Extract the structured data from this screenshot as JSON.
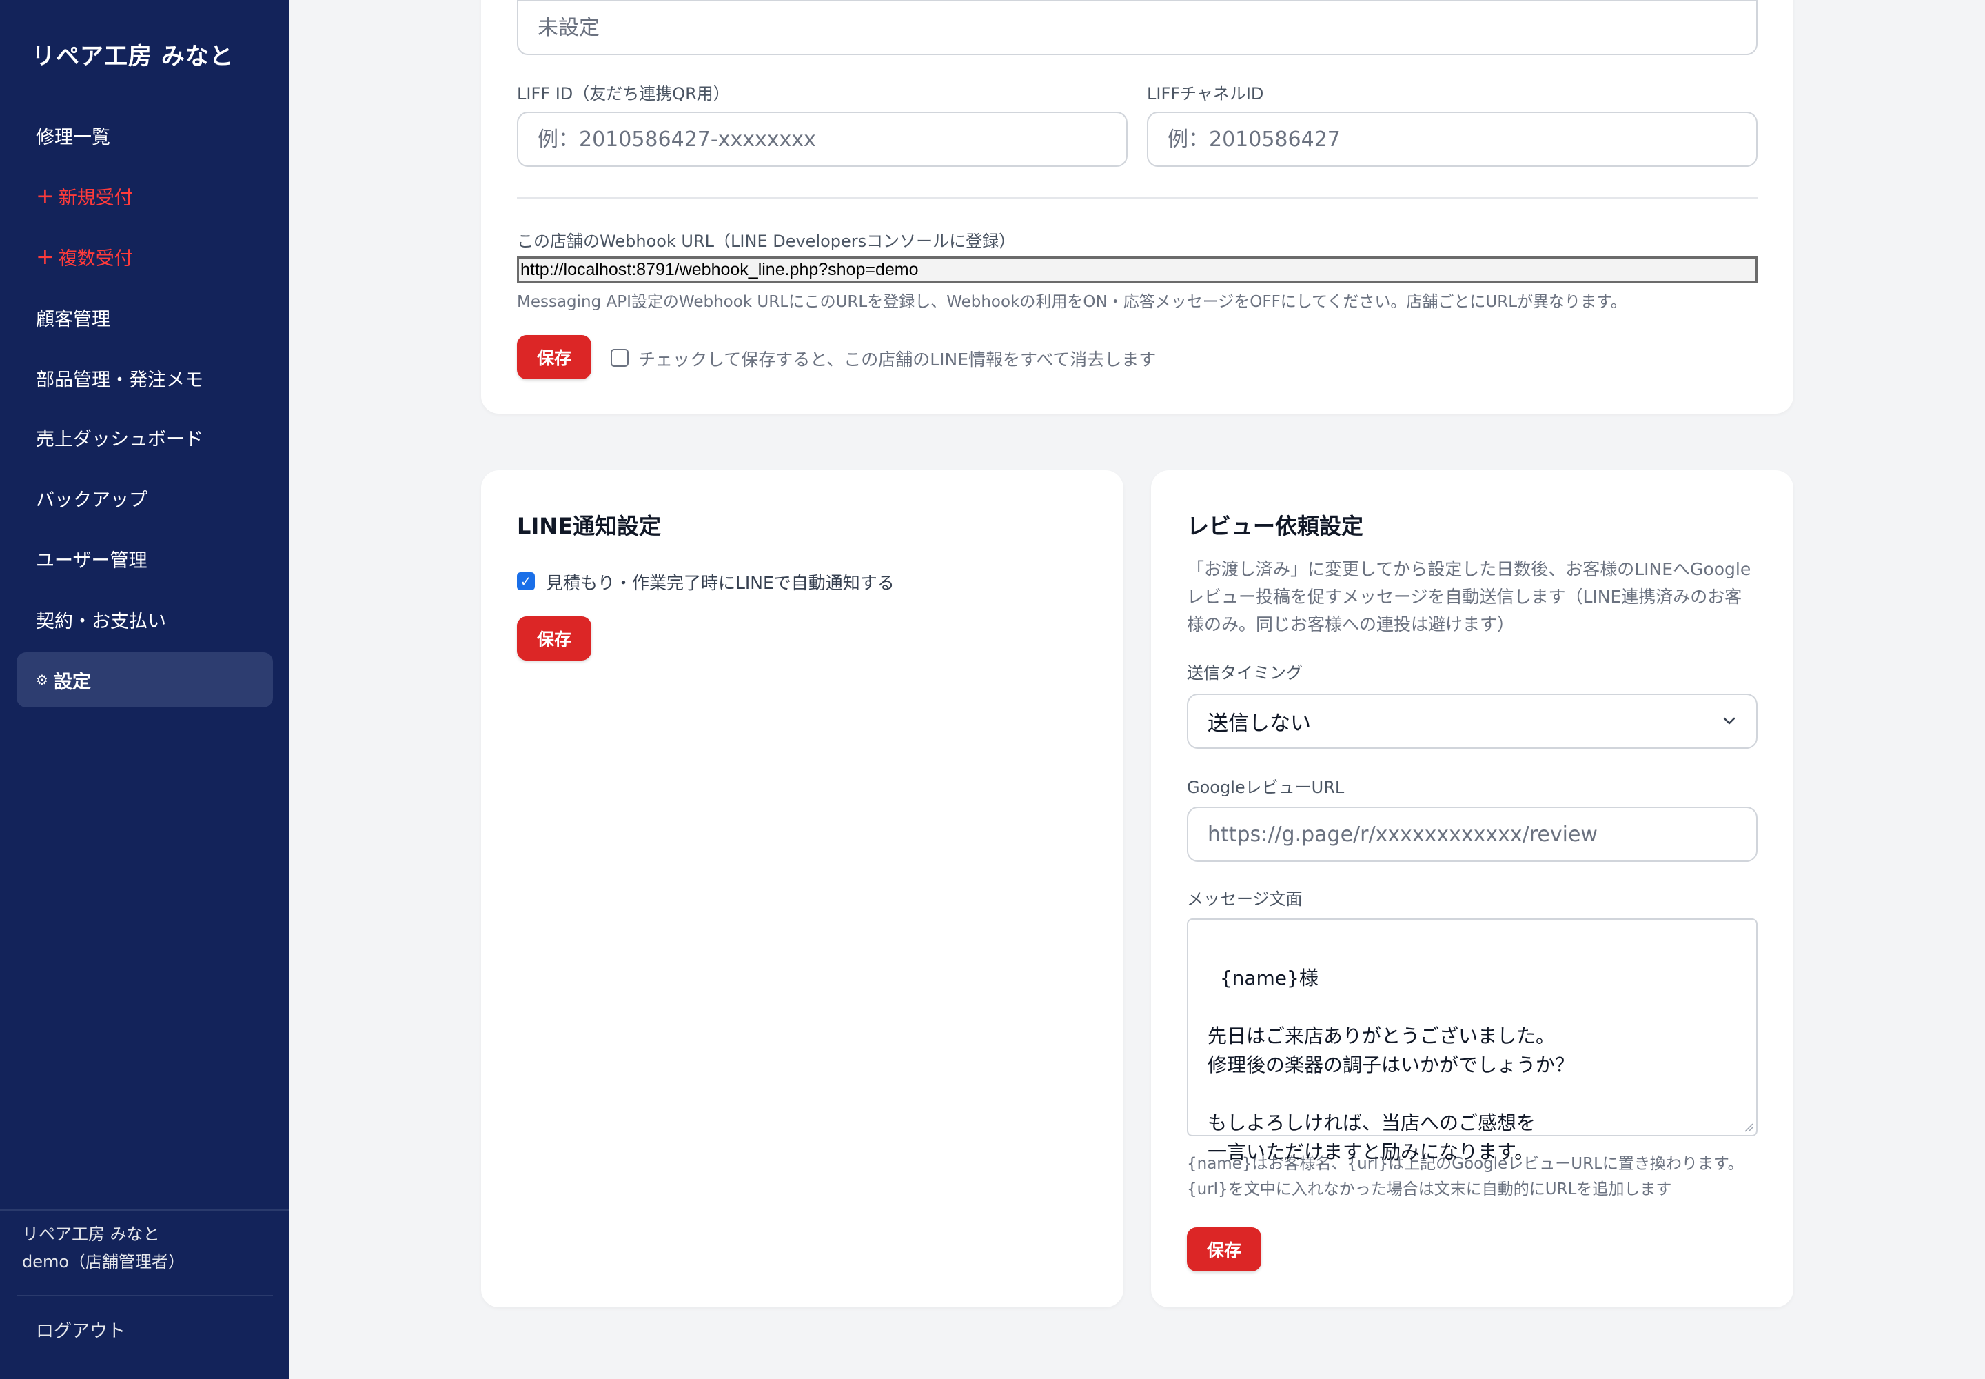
{
  "sidebar": {
    "brand": "リペア工房 みなと",
    "items": [
      {
        "label": "修理一覧"
      },
      {
        "prefix": "+",
        "label": "新規受付"
      },
      {
        "prefix": "+",
        "label": "複数受付"
      },
      {
        "label": "顧客管理"
      },
      {
        "label": "部品管理・発注メモ"
      },
      {
        "label": "売上ダッシュボード"
      },
      {
        "label": "バックアップ"
      },
      {
        "label": "ユーザー管理"
      },
      {
        "label": "契約・お支払い"
      },
      {
        "icon": "⚙",
        "label": "設定"
      }
    ],
    "shop_name": "リペア工房 みなと",
    "user": "demo（店舗管理者）",
    "logout": "ログアウト"
  },
  "line_card": {
    "top_input_placeholder": "未設定",
    "liff_id_label": "LIFF ID（友だち連携QR用）",
    "liff_id_placeholder": "例：2010586427-xxxxxxxx",
    "liff_channel_label": "LIFFチャネルID",
    "liff_channel_placeholder": "例：2010586427",
    "webhook_label": "この店舗のWebhook URL（LINE Developersコンソールに登録）",
    "webhook_url": "http://localhost:8791/webhook_line.php?shop=demo",
    "webhook_help": "Messaging API設定のWebhook URLにこのURLを登録し、Webhookの利用をON・応答メッセージをOFFにしてください。店舗ごとにURLが異なります。",
    "save": "保存",
    "clear_label": "チェックして保存すると、この店舗のLINE情報をすべて消去します"
  },
  "notify_card": {
    "title": "LINE通知設定",
    "auto_notify_label": "見積もり・作業完了時にLINEで自動通知する",
    "auto_notify_checked": true,
    "save": "保存"
  },
  "review_card": {
    "title": "レビュー依頼設定",
    "description": "「お渡し済み」に変更してから設定した日数後、お客様のLINEへGoogleレビュー投稿を促すメッセージを自動送信します（LINE連携済みのお客様のみ。同じお客様への連投は避けます）",
    "timing_label": "送信タイミング",
    "timing_value": "送信しない",
    "url_label": "GoogleレビューURL",
    "url_placeholder": "https://g.page/r/xxxxxxxxxxxx/review",
    "message_label": "メッセージ文面",
    "message_text": "{name}様\n\n先日はご来店ありがとうございました。\n修理後の楽器の調子はいかがでしょうか？\n\nもしよろしければ、当店へのご感想を\n一言いただけますと励みになります。",
    "help": "{name}はお客様名、{url}は上記のGoogleレビューURLに置き換わります。\n{url}を文中に入れなかった場合は文末に自動的にURLを追加します",
    "save": "保存"
  },
  "colors": {
    "sidebar_bg": "#13235a",
    "accent_red": "#dc2626",
    "active_item_bg": "#2d3d70",
    "checkbox_blue": "#1a6fe8"
  }
}
